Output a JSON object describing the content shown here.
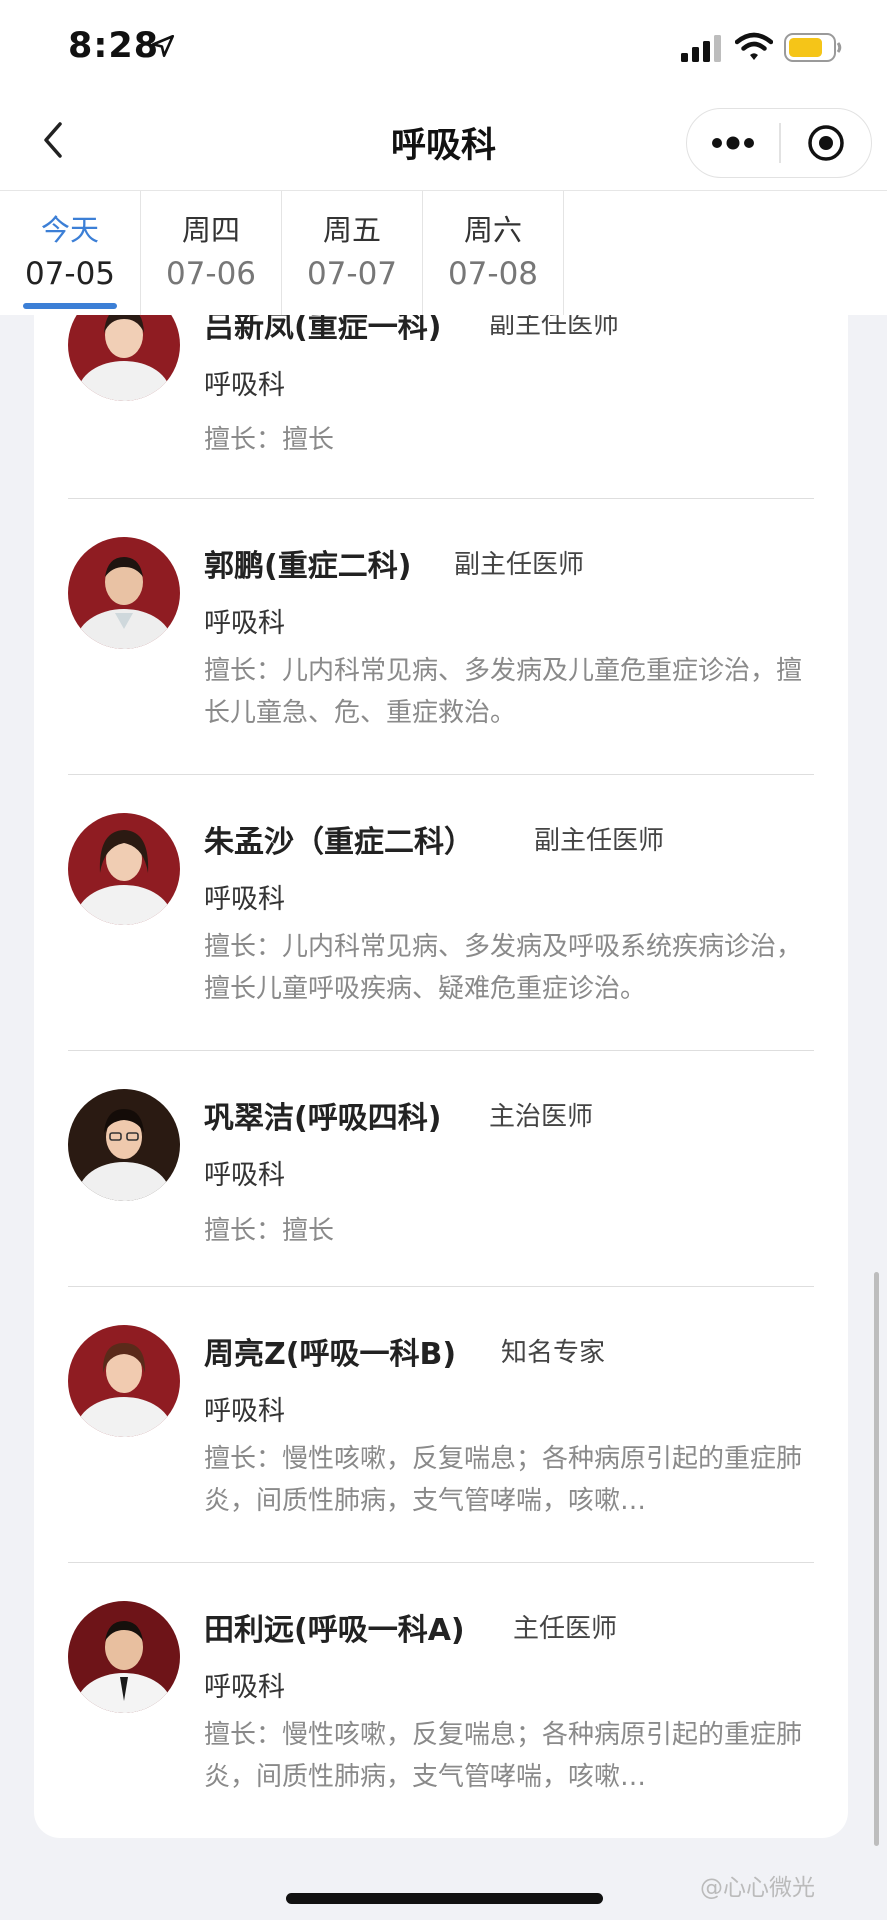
{
  "status_bar": {
    "time": "8:28",
    "icons": [
      "location-arrow-icon",
      "signal-icon",
      "wifi-icon",
      "battery-icon"
    ],
    "battery_color": "#f5c518"
  },
  "nav": {
    "title": "呼吸科",
    "back_icon": "chevron-left-icon",
    "more_icon": "more-dots-icon",
    "close_icon": "mini-program-close-icon"
  },
  "date_tabs": [
    {
      "weekday": "今天",
      "date": "07-05",
      "active": true
    },
    {
      "weekday": "周四",
      "date": "07-06",
      "active": false
    },
    {
      "weekday": "周五",
      "date": "07-07",
      "active": false
    },
    {
      "weekday": "周六",
      "date": "07-08",
      "active": false
    }
  ],
  "accent_color": "#3c7fd6",
  "doctors": [
    {
      "name": "吕新凤(重症一科)",
      "title": "副主任医师",
      "department": "呼吸科",
      "specialty": "擅长：擅长"
    },
    {
      "name": "郭鹏(重症二科)",
      "title": "副主任医师",
      "department": "呼吸科",
      "specialty": "擅长：儿内科常见病、多发病及儿童危重症诊治，擅长儿童急、危、重症救治。"
    },
    {
      "name": "朱孟沙（重症二科）",
      "title": "副主任医师",
      "department": "呼吸科",
      "specialty": "擅长：儿内科常见病、多发病及呼吸系统疾病诊治，擅长儿童呼吸疾病、疑难危重症诊治。"
    },
    {
      "name": "巩翠洁(呼吸四科)",
      "title": "主治医师",
      "department": "呼吸科",
      "specialty": "擅长：擅长"
    },
    {
      "name": "周亮Z(呼吸一科B)",
      "title": "知名专家",
      "department": "呼吸科",
      "specialty": "擅长：慢性咳嗽，反复喘息；各种病原引起的重症肺炎，间质性肺病，支气管哮喘，咳嗽…"
    },
    {
      "name": "田利远(呼吸一科A)",
      "title": "主任医师",
      "department": "呼吸科",
      "specialty": "擅长：慢性咳嗽，反复喘息；各种病原引起的重症肺炎，间质性肺病，支气管哮喘，咳嗽…"
    }
  ],
  "watermark": "@心心微光"
}
